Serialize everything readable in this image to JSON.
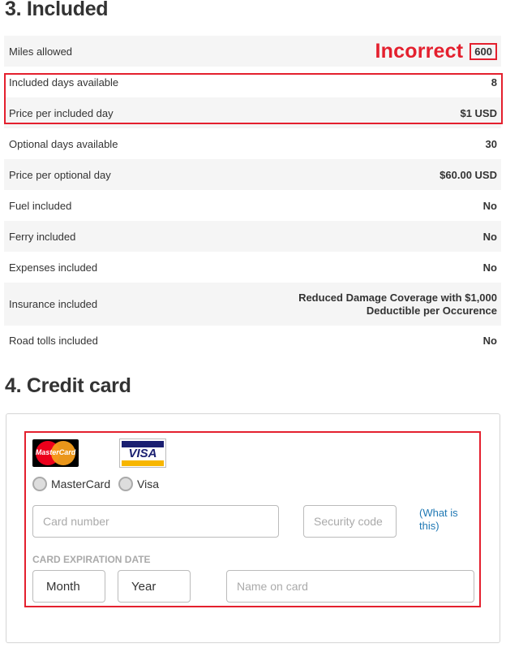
{
  "included": {
    "title": "3. Included",
    "incorrect_annotation": "Incorrect",
    "rows": [
      {
        "label": "Miles allowed",
        "value": "600"
      },
      {
        "label": "Included days available",
        "value": "8"
      },
      {
        "label": "Price per included day",
        "value": "$1 USD"
      },
      {
        "label": "Optional days available",
        "value": "30"
      },
      {
        "label": "Price per optional day",
        "value": "$60.00 USD"
      },
      {
        "label": "Fuel included",
        "value": "No"
      },
      {
        "label": "Ferry included",
        "value": "No"
      },
      {
        "label": "Expenses included",
        "value": "No"
      },
      {
        "label": "Insurance included",
        "value": "Reduced Damage Coverage with $1,000 Deductible per Occurence"
      },
      {
        "label": "Road tolls included",
        "value": "No"
      }
    ]
  },
  "credit_card": {
    "title": "4. Credit card",
    "logos": {
      "mastercard": "MasterCard",
      "visa": "VISA"
    },
    "radio_mastercard": "MasterCard",
    "radio_visa": "Visa",
    "card_number_placeholder": "Card number",
    "security_code_placeholder": "Security code",
    "what_is_this": "(What is this)",
    "expiration_label": "CARD EXPIRATION DATE",
    "month": "Month",
    "year": "Year",
    "name_placeholder": "Name on card"
  },
  "colors": {
    "annotation_red": "#e4202e",
    "link_blue": "#1f78b4",
    "row_stripe": "#f5f5f5"
  }
}
